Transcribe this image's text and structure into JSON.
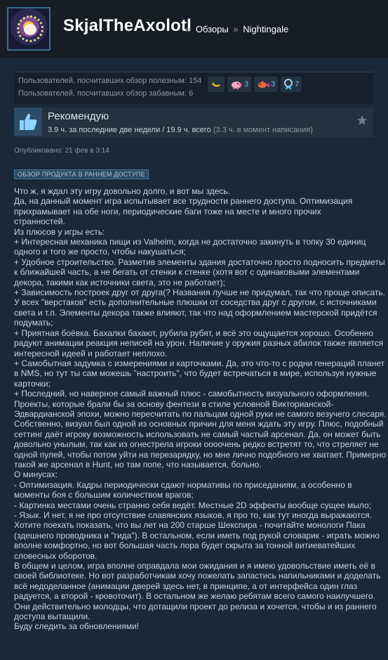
{
  "header": {
    "username": "SkjalTheAxolotl",
    "crumb_sep": "»",
    "crumbs": [
      "Обзоры",
      "Nightingale"
    ]
  },
  "votes": {
    "helpful": "Пользователей, посчитавших обзор полезным: 154",
    "funny": "Пользователей, посчитавших обзор забавным: 6",
    "awards": [
      {
        "icon": "banana-award-icon",
        "count": ""
      },
      {
        "icon": "pig-award-icon",
        "count": "3"
      },
      {
        "icon": "fish-award-icon",
        "count": "3"
      },
      {
        "icon": "medal-award-icon",
        "count": "7"
      }
    ]
  },
  "recommendation": {
    "title": "Рекомендую",
    "hours_recent": "3.9 ч. за последние две недели / 19.9 ч. всего",
    "hours_at_writing": "(3.3 ч. в момент написания)"
  },
  "posted": "Опубликовано: 21 фев в 3:14",
  "early_access_badge": "ОБЗОР ПРОДУКТА В РАННЕМ ДОСТУПЕ",
  "review_lines": [
    "Что ж, я ждал эту игру довольно долго, и вот мы здесь.",
    "Да, на данный момент игра испытывает все трудности раннего доступа. Оптимизация",
    "прихрамывает на обе ноги, периодические баги тоже на месте и много прочих",
    "странностей.",
    "Из плюсов у игры есть:",
    "+ Интересная механика пищи из Valheim, когда не достаточно закинуть в топку 30 единиц",
    "одного и того же просто, чтобы накушаться;",
    "+ Удобное строительство. Разметив элементы здания достаточно просто подносить предметы",
    "к ближайшей часть, а не бегать от стенки к стенке (хотя вот с одинаковыми элементами",
    "декора, такими как источники света, это не работает);",
    "+ Зависимость построек друг от друга(? Названия лучше не придумал, так что проще описать.",
    "У всех \"верстаков\" есть дополнительные плюшки от соседства друг с другом, с источниками",
    "света и т.п. Элементы декора также влияют, так что над оформлением мастерской придётся",
    "подумать;",
    "+ Приятная боёвка. Бахалки бахают, рубила рубят, и всё это ощущается хорошо. Особенно",
    "радуют анимации реакция неписей на урон. Наличие у оружия разных абилок также является",
    "интересной идеей и работает неплохо.",
    "+ Самобытная задумка с измерениями и карточками. Да, это что-то с родни генераций планет",
    "в NMS, но тут ты сам можешь \"настроить\", что будет встречаться в мире, используя нужные",
    "карточки;",
    "+ Последний, но наверное самый важный плюс - самобытность визуального оформления.",
    "Проекты, которые брали бы за основу фентези в стиле условной Викторианской-",
    "Эдвардианской эпохи, можно пересчитать по пальцам одной руки не самого везучего слесаря.",
    "Собственно, визуал был одной из основных причин для меня ждать эту игру. Плюс, подобный",
    "сеттинг даёт игроку возможность использовать не самый частый арсенал. Да, он может быть",
    "довольно унылым, так как из огнестрела игроки оооочень редко встретят то, что стреляет не",
    "одной пулей, чтобы потом уйти на перезарядку, но мне лично подобного не хватает. Примерно",
    "такой же арсенал в Hunt, но там попе, что называется, больно.",
    "О минусах:",
    "- Оптимизация. Кадры периодически сдают нормативы по приседаниям, а особенно в",
    "моменты боя с большим количеством врагов;",
    "- Картинка местами очень странно себя ведёт. Местные 2D эффекты вообще сущее мыло;",
    "- Язык. И нет, я не про отсутствие славянских языков, я про то, как тут иногда выражаются.",
    "Хотите поехать показать, что вы лет на 200 старше Шекспира - почитайте монологи Пака",
    "(здешнего проводника и \"гида\"). В остальном, если иметь под рукой словарик - играть можно",
    "вполне комфортно, но вот большая часть лора будет скрыта за тонной витиеватейших",
    "словесных оборотов.",
    "В общем и целом, игра вполне оправдала мои ожидания и я имею удовольствие иметь её в",
    "своей библиотеке. Но вот разработчикам хочу пожелать запастись напильниками и доделать",
    "всё недоделанное (анимации дверей здесь нет, в принципе, а от интерфейса один глаз",
    "радуется, а второй - кровоточит). В остальном же желаю ребятам всего самого наилучшего.",
    "Они действительно молодцы, что дотащили проект до релиза и хочется, чтобы и из раннего",
    "доступа вытащили.",
    "Буду следить за обновлениями!"
  ],
  "colors": {
    "background": "#1b2838",
    "header": "#171d25",
    "accent_link": "#66c0f4",
    "thumb_up": "#66c0f4"
  }
}
